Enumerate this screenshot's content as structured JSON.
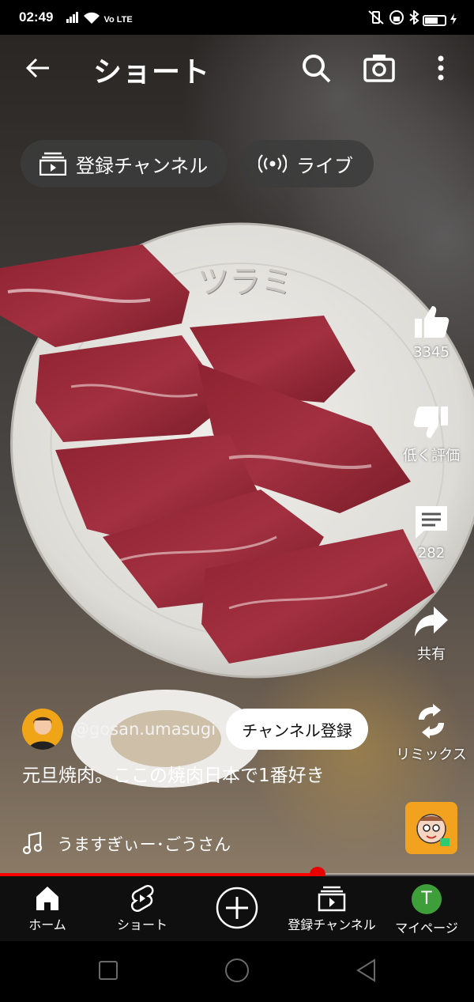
{
  "status_bar": {
    "time": "02:49",
    "network": "Vo LTE"
  },
  "header": {
    "title": "ショート"
  },
  "chips": [
    {
      "label": "登録チャンネル"
    },
    {
      "label": "ライブ"
    }
  ],
  "video": {
    "overlay_text": "ツラミ"
  },
  "actions": {
    "like_count": "3345",
    "dislike_label": "低く評価",
    "comment_count": "282",
    "share_label": "共有",
    "remix_label": "リミックス"
  },
  "channel": {
    "handle": "@gosan.umasugi",
    "subscribe_label": "チャンネル登録"
  },
  "caption": "元旦焼肉。ここの焼肉日本で1番好き",
  "music": "うますぎぃー･ごうさん",
  "progress": 0.67,
  "bottom_nav": {
    "home": "ホーム",
    "shorts": "ショート",
    "subscriptions": "登録チャンネル",
    "my_page": "マイページ",
    "avatar_letter": "T"
  },
  "colors": {
    "accent": "#ff0000",
    "nav_bg": "#0f0f0f",
    "avatar_bg": "#3e9e3a"
  }
}
